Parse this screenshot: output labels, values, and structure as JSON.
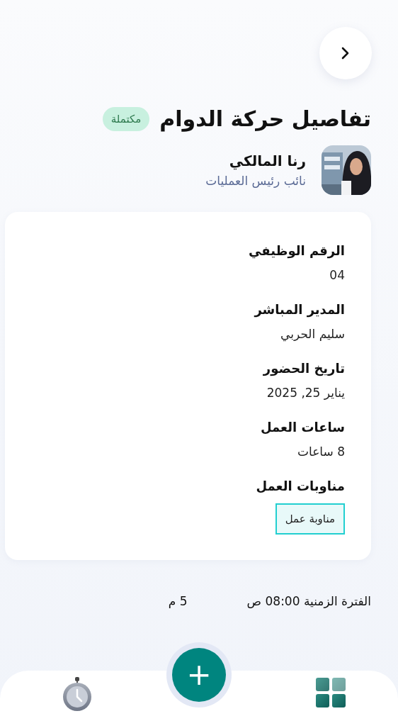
{
  "header": {
    "title": "تفاصيل حركة الدوام",
    "status": {
      "label": "مكتملة",
      "kind": "completed"
    }
  },
  "employee": {
    "name": "رنا المالكي",
    "position": "نائب رئيس العمليات"
  },
  "details": [
    {
      "kind": "text",
      "label": "الرقم الوظيفي",
      "value": "04"
    },
    {
      "kind": "text",
      "label": "المدير المباشر",
      "value": "سليم الحربي"
    },
    {
      "kind": "text",
      "label": "تاريخ الحضور",
      "value": "يناير 25, 2025"
    },
    {
      "kind": "text",
      "label": "ساعات العمل",
      "value": "8 ساعات"
    },
    {
      "kind": "chips",
      "label": "مناوبات العمل",
      "chips": [
        "مناوبة عمل"
      ]
    }
  ],
  "time_range": {
    "start_text": "الفترة الزمنية 08:00 ص",
    "end_text": "5 م"
  },
  "fab": {
    "label": "+"
  }
}
